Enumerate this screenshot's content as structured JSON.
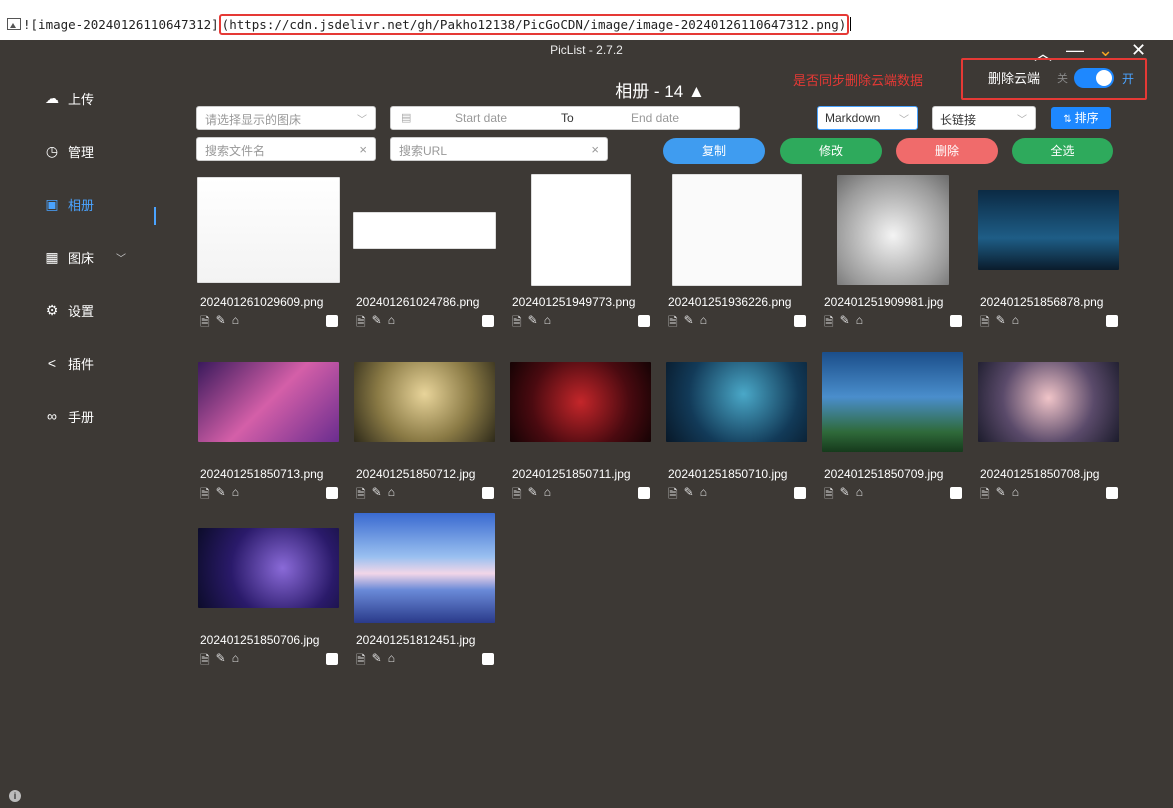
{
  "editor": {
    "text_prefix": "![image-20240126110647312]",
    "url": "(https://cdn.jsdelivr.net/gh/Pakho12138/PicGoCDN/image/image-20240126110647312.png)"
  },
  "app": {
    "title": "PicList - 2.7.2",
    "page_title": "相册 - 14 ▲",
    "window_controls": [
      "^",
      "—",
      "⌄",
      "✕"
    ]
  },
  "sidebar": {
    "items": [
      {
        "label": "上传",
        "icon": "cloud-upload-icon",
        "glyph": "☁"
      },
      {
        "label": "管理",
        "icon": "pie-chart-icon",
        "glyph": "◷"
      },
      {
        "label": "相册",
        "icon": "image-icon",
        "glyph": "▣"
      },
      {
        "label": "图床",
        "icon": "grid-icon",
        "glyph": "▦"
      },
      {
        "label": "设置",
        "icon": "gear-icon",
        "glyph": "⚙"
      },
      {
        "label": "插件",
        "icon": "share-icon",
        "glyph": "<"
      },
      {
        "label": "手册",
        "icon": "link-icon",
        "glyph": "∞"
      }
    ]
  },
  "sync": {
    "note": "是否同步删除云端数据",
    "label": "删除云端",
    "off": "关",
    "on": "开"
  },
  "filters": {
    "bed_placeholder": "请选择显示的图床",
    "start_date": "Start date",
    "to": "To",
    "end_date": "End date",
    "format": "Markdown",
    "link_type": "长链接",
    "sort": "排序",
    "search_name_placeholder": "搜索文件名",
    "search_url_placeholder": "搜索URL"
  },
  "actions": {
    "copy": "复制",
    "modify": "修改",
    "delete": "删除",
    "select_all": "全选"
  },
  "colors": {
    "copy": "#3f9cf0",
    "modify": "#2eaa5c",
    "delete": "#f06b6b",
    "select_all": "#2eaa5c",
    "accent": "#1e88ff",
    "annotation": "#e53935"
  },
  "images": [
    {
      "name": "202401261029609.png"
    },
    {
      "name": "202401261024786.png"
    },
    {
      "name": "202401251949773.png"
    },
    {
      "name": "202401251936226.png"
    },
    {
      "name": "202401251909981.jpg"
    },
    {
      "name": "202401251856878.png"
    },
    {
      "name": "202401251850713.png"
    },
    {
      "name": "202401251850712.jpg"
    },
    {
      "name": "202401251850711.jpg"
    },
    {
      "name": "202401251850710.jpg"
    },
    {
      "name": "202401251850709.jpg"
    },
    {
      "name": "202401251850708.jpg"
    },
    {
      "name": "202401251850706.jpg"
    },
    {
      "name": "202401251812451.jpg"
    }
  ]
}
